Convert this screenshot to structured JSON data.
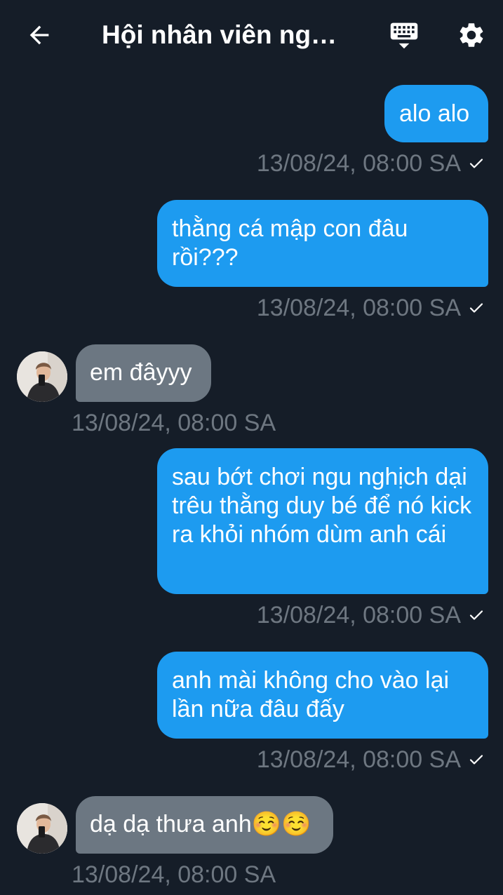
{
  "header": {
    "title": "Hội nhân viên ng…",
    "back_icon": "arrow-left-icon",
    "keyboard_icon": "keyboard-icon",
    "settings_icon": "gear-icon"
  },
  "colors": {
    "background": "#151d28",
    "outgoing_bubble": "#1d9bf0",
    "incoming_bubble": "#6c7782",
    "timestamp": "#6e7781"
  },
  "messages": [
    {
      "direction": "out",
      "text": "alo alo",
      "time": "13/08/24, 08:00 SA"
    },
    {
      "direction": "out",
      "text": "thằng cá mập con đâu rồi???",
      "time": "13/08/24, 08:00 SA"
    },
    {
      "direction": "in",
      "text": "em đâyyy",
      "time": "13/08/24, 08:00 SA"
    },
    {
      "direction": "out",
      "text": "sau bớt chơi ngu nghịch dại trêu thằng duy bé để nó kick ra khỏi nhóm dùm anh cái",
      "time": "13/08/24, 08:00 SA"
    },
    {
      "direction": "out",
      "text": "anh mài không cho vào lại lần nữa đâu đấy",
      "time": "13/08/24, 08:00 SA"
    },
    {
      "direction": "in",
      "text": "dạ dạ thưa anh☺️☺️",
      "time": "13/08/24, 08:00 SA"
    }
  ]
}
